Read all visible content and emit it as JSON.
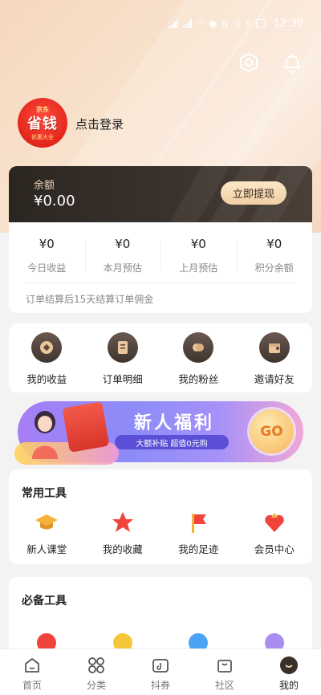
{
  "status_bar": {
    "time": "12:39"
  },
  "profile": {
    "avatar_top": "京东",
    "avatar_main": "省钱",
    "avatar_sub": "优惠大全",
    "login_label": "点击登录"
  },
  "balance": {
    "label": "余额",
    "value": "¥0.00",
    "withdraw_label": "立即提现"
  },
  "earnings": {
    "items": [
      {
        "value": "¥0",
        "label": "今日收益"
      },
      {
        "value": "¥0",
        "label": "本月预估"
      },
      {
        "value": "¥0",
        "label": "上月预估"
      },
      {
        "value": "¥0",
        "label": "积分余额"
      }
    ],
    "note": "订单结算后15天结算订单佣金"
  },
  "quick_actions": [
    {
      "label": "我的收益",
      "icon": "coin-icon"
    },
    {
      "label": "订单明细",
      "icon": "order-icon"
    },
    {
      "label": "我的粉丝",
      "icon": "heart-icon"
    },
    {
      "label": "邀请好友",
      "icon": "invite-icon"
    }
  ],
  "banner": {
    "title": "新人福利",
    "subtitle": "大额补贴 超值0元购",
    "go_label": "GO"
  },
  "common_tools": {
    "title": "常用工具",
    "items": [
      {
        "label": "新人课堂",
        "icon": "graduation-cap-icon",
        "color": "#f5b23a"
      },
      {
        "label": "我的收藏",
        "icon": "star-icon",
        "color": "#f0433b"
      },
      {
        "label": "我的足迹",
        "icon": "flag-icon",
        "color": "#f0433b"
      },
      {
        "label": "会员中心",
        "icon": "crown-heart-icon",
        "color": "#f0433b"
      }
    ]
  },
  "essential_tools": {
    "title": "必备工具",
    "icons": [
      {
        "icon": "robot-icon",
        "color": "#f0433b"
      },
      {
        "icon": "note-icon",
        "color": "#f5c63a"
      },
      {
        "icon": "help-icon",
        "color": "#4aa3f5"
      },
      {
        "icon": "info-icon",
        "color": "#a98cf0"
      }
    ]
  },
  "bottom_nav": [
    {
      "label": "首页",
      "icon": "home-icon"
    },
    {
      "label": "分类",
      "icon": "grid-icon"
    },
    {
      "label": "抖券",
      "icon": "tiktok-icon"
    },
    {
      "label": "社区",
      "icon": "bag-icon"
    },
    {
      "label": "我的",
      "icon": "profile-icon"
    }
  ]
}
